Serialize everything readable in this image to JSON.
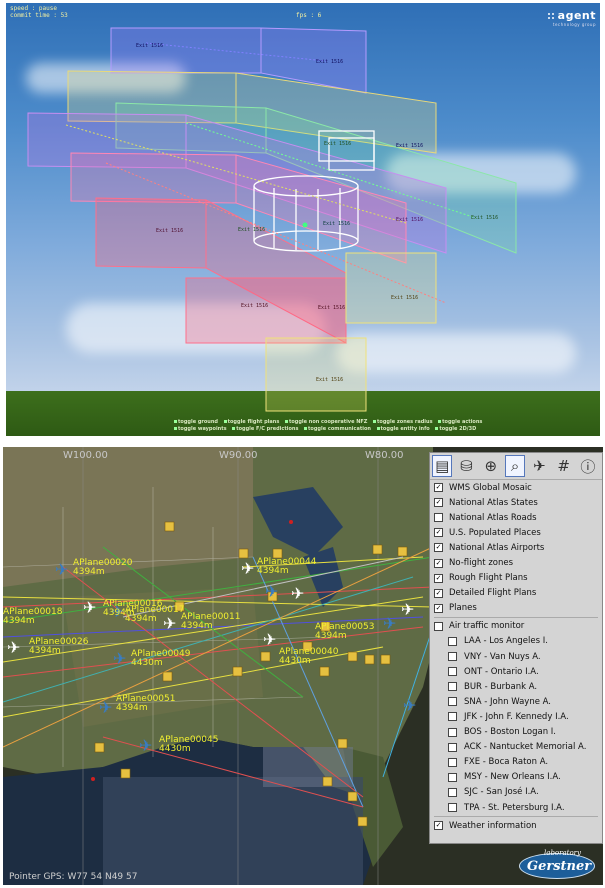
{
  "view3d": {
    "hud": {
      "speed": "speed : pause",
      "commit": "commit time : 53",
      "fps": "fps : 6"
    },
    "logo": {
      "name": "agent",
      "tagline": "technology group"
    },
    "waypoint_labels": [
      "Exit 1516",
      "Exit 1516",
      "Exit 1516",
      "Exit 1516",
      "Exit 1516",
      "Exit 1516",
      "Exit 1516",
      "Exit 1516",
      "Exit 1516",
      "Exit 1516",
      "Exit 1516",
      "Exit 1516",
      "Exit 1516"
    ],
    "toggles": {
      "row1": [
        "toggle ground",
        "toggle flight plans",
        "toggle non cooperative NFZ",
        "toggle zones radius",
        "toggle actions"
      ],
      "row2": [
        "toggle waypoints",
        "toggle F/C predictions",
        "toggle communication",
        "toggle entity info",
        "toggle 2D/3D"
      ]
    }
  },
  "map": {
    "degree_labels": [
      "W100.00",
      "W90.00",
      "W80.00"
    ],
    "pointer_gps": "Pointer GPS: W77 54   N49 57",
    "planes": [
      {
        "name": "APlane00020",
        "alt": "4394m"
      },
      {
        "name": "APlane00016",
        "alt": "4394m"
      },
      {
        "name": "APlane00017",
        "alt": "4394m"
      },
      {
        "name": "APlane00018",
        "alt": "4394m"
      },
      {
        "name": "APlane00011",
        "alt": "4394m"
      },
      {
        "name": "APlane00026",
        "alt": "4394m"
      },
      {
        "name": "APlane00049",
        "alt": "4430m"
      },
      {
        "name": "APlane00051",
        "alt": "4394m"
      },
      {
        "name": "APlane00045",
        "alt": "4430m"
      },
      {
        "name": "APlane00040",
        "alt": "4430m"
      },
      {
        "name": "APlane00044",
        "alt": "4394m"
      },
      {
        "name": "APlane00053",
        "alt": "4394m"
      }
    ],
    "lab_logo": {
      "top": "laboratory",
      "name": "Gerstner"
    },
    "toolbar_icons": [
      "layers-icon",
      "database-icon",
      "zoom-in-icon",
      "select-zoom-icon",
      "plane-icon",
      "grid-icon",
      "info-icon"
    ],
    "layers": [
      {
        "label": "WMS Global Mosaic",
        "checked": true
      },
      {
        "label": "National Atlas States",
        "checked": true
      },
      {
        "label": "National Atlas Roads",
        "checked": false
      },
      {
        "label": "U.S. Populated Places",
        "checked": true
      },
      {
        "label": "National Atlas Airports",
        "checked": true
      },
      {
        "label": "No-flight zones",
        "checked": true
      },
      {
        "label": "Rough Flight Plans",
        "checked": true
      },
      {
        "label": "Detailed Flight Plans",
        "checked": true
      },
      {
        "label": "Planes",
        "checked": true
      }
    ],
    "traffic_monitor": {
      "label": "Air traffic monitor",
      "checked": false
    },
    "airports": [
      "LAA - Los Angeles I.",
      "VNY - Van Nuys A.",
      "ONT - Ontario I.A.",
      "BUR - Burbank A.",
      "SNA - John Wayne A.",
      "JFK - John F. Kennedy I.A.",
      "BOS - Boston Logan I.",
      "ACK - Nantucket Memorial A.",
      "FXE - Boca Raton A.",
      "MSY - New Orleans I.A.",
      "SJC - San José I.A.",
      "TPA - St. Petersburg I.A."
    ],
    "weather": {
      "label": "Weather information",
      "checked": true
    }
  }
}
